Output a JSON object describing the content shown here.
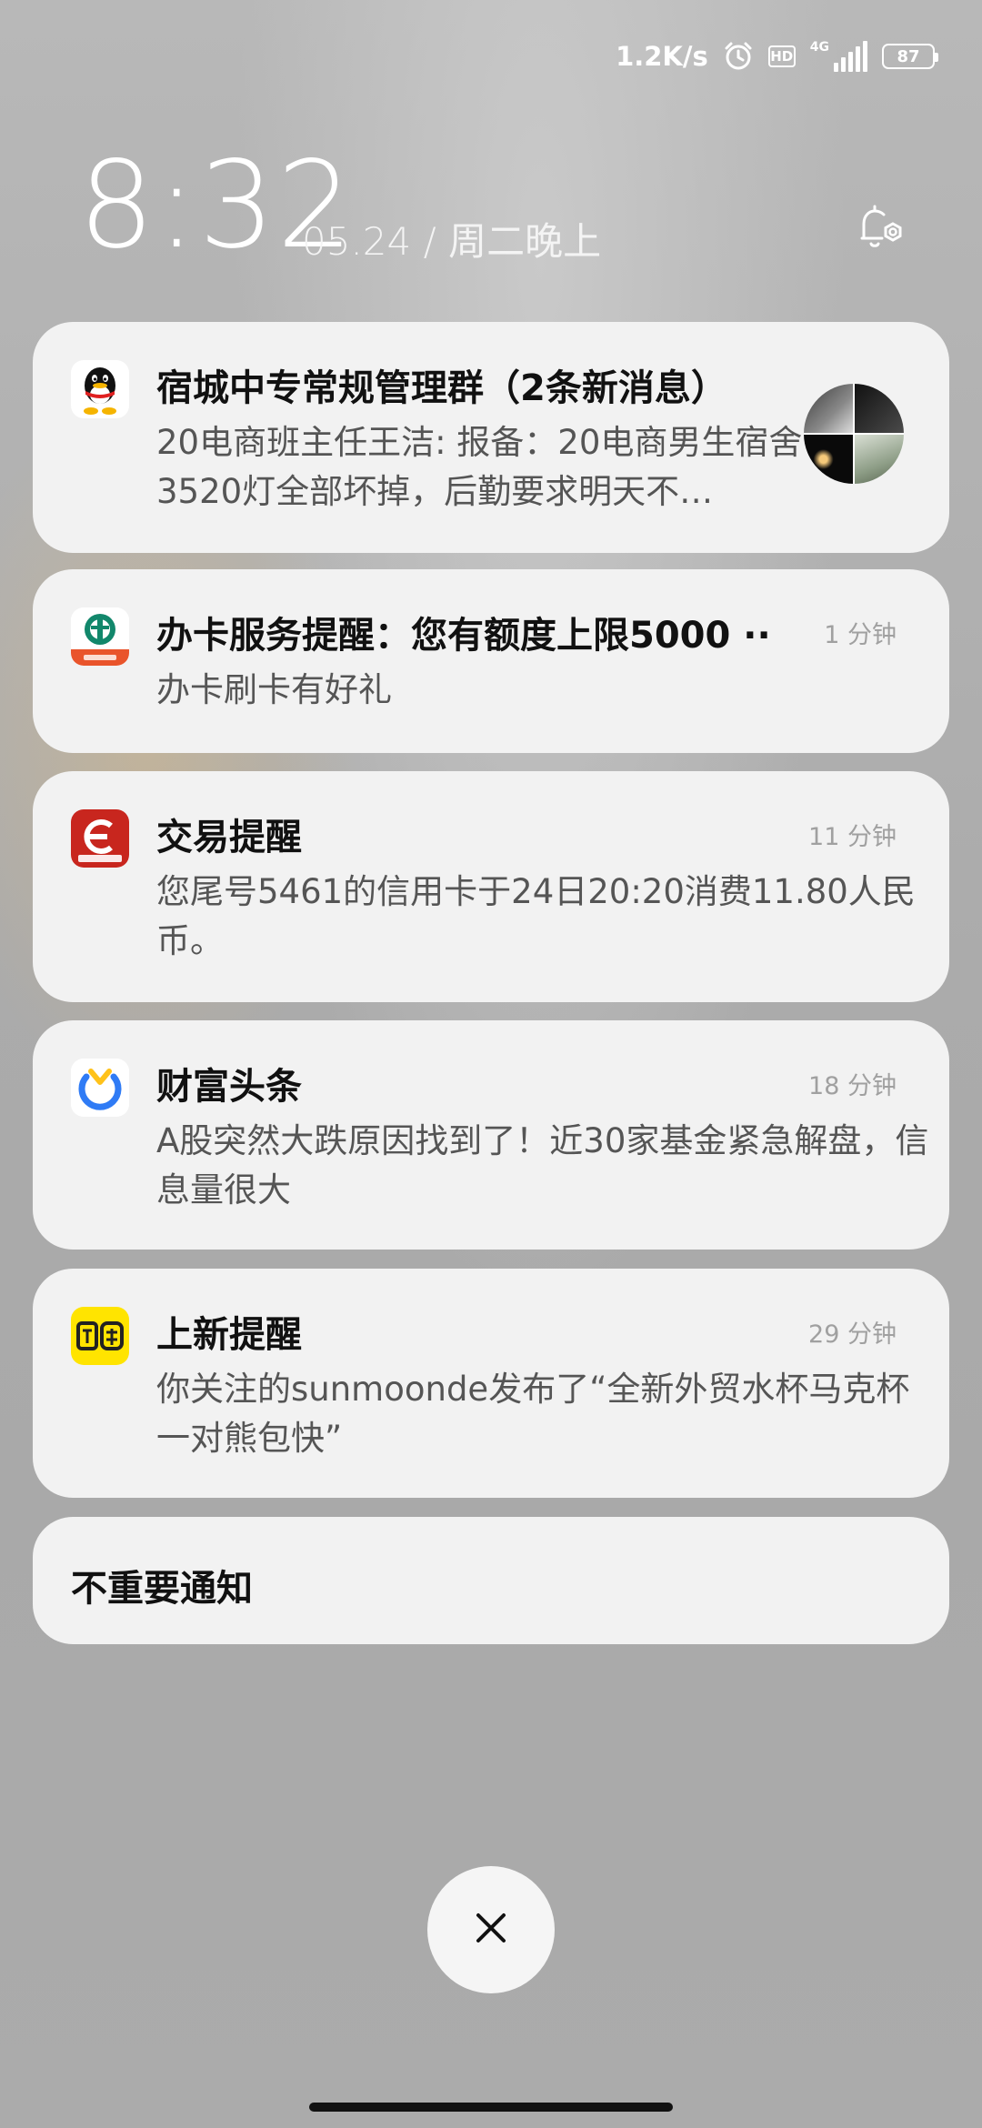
{
  "status_bar": {
    "net_speed": "1.2K/s",
    "alarm_icon": "alarm-clock-icon",
    "hd_label": "HD",
    "network_type": "4G",
    "battery_level": "87"
  },
  "lockscreen": {
    "time": "8:32",
    "date": "05.24 / 周二晚上",
    "settings_icon": "bell-settings-icon"
  },
  "notifications": [
    {
      "app_icon": "qq-icon",
      "title": "宿城中专常规管理群（2条新消息）",
      "time": "",
      "body": "20电商班主任王洁: 报备：20电商男生宿舍3520灯全部坏掉，后勤要求明天不…"
    },
    {
      "app_icon": "bank-icon",
      "title": "办卡服务提醒：您有额度上限5000 ··",
      "time": "1 分钟",
      "body": "办卡刷卡有好礼"
    },
    {
      "app_icon": "bank-card-icon",
      "title": "交易提醒",
      "time": "11 分钟",
      "body": "您尾号5461的信用卡于24日20:20消费11.80人民币。"
    },
    {
      "app_icon": "fortune-news-icon",
      "title": "财富头条",
      "time": "18 分钟",
      "body": "A股突然大跌原因找到了！近30家基金紧急解盘，信息量很大"
    },
    {
      "app_icon": "xianyu-icon",
      "title": "上新提醒",
      "time": "29 分钟",
      "body": "你关注的sunmoonde发布了“全新外贸水杯马克杯一对熊包快”"
    }
  ],
  "unimportant": {
    "label": "不重要通知"
  },
  "controls": {
    "close_icon": "close-icon"
  },
  "colors": {
    "card_bg": "#f2f2f2",
    "xianyu_yellow": "#ffe400",
    "bank_green": "#12876b",
    "bank_red": "#c8261e",
    "fortune_blue": "#2f7bf5",
    "fortune_yellow": "#ffc21a"
  }
}
